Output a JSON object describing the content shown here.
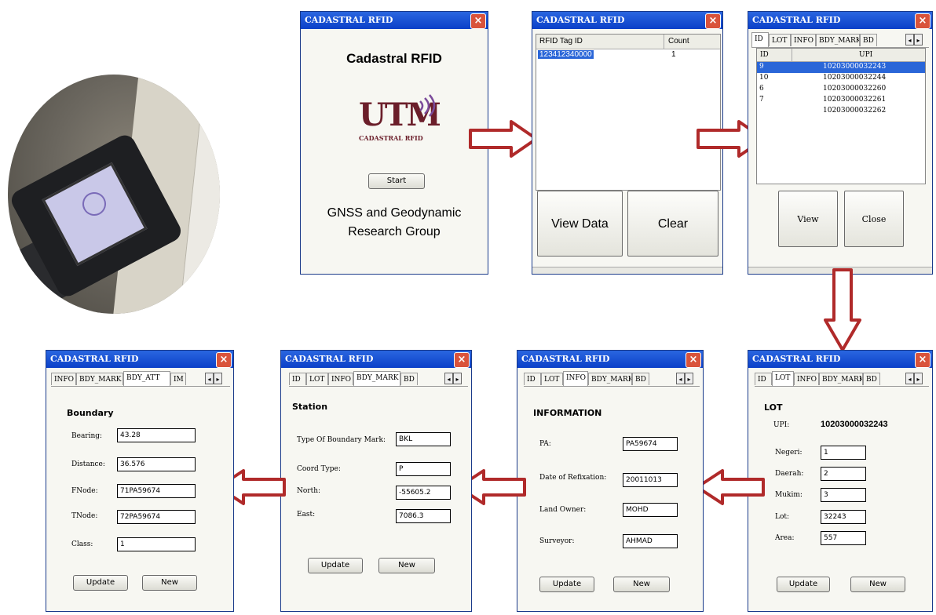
{
  "app_title": "CADASTRAL RFID",
  "close_glyph": "×",
  "colors": {
    "titlebar": "#0b40c8",
    "selection": "#2a66d8",
    "arrow": "#b02a2a"
  },
  "splash": {
    "heading": "Cadastral RFID",
    "logo_text": "UTM",
    "logo_subtext": "CADASTRAL RFID",
    "start_label": "Start",
    "group_line1": "GNSS and Geodynamic",
    "group_line2": "Research Group"
  },
  "reader": {
    "col_tag": "RFID Tag ID",
    "col_count": "Count",
    "rows": [
      {
        "tag": "123412340000",
        "count": "1"
      }
    ],
    "view_data_label": "View Data",
    "clear_label": "Clear"
  },
  "list": {
    "tabs": [
      "ID",
      "LOT",
      "INFO",
      "BDY_MARK",
      "BD"
    ],
    "col_id": "ID",
    "col_upi": "UPI",
    "rows": [
      {
        "id": "9",
        "upi": "10203000032243"
      },
      {
        "id": "10",
        "upi": "10203000032244"
      },
      {
        "id": "6",
        "upi": "10203000032260"
      },
      {
        "id": "7",
        "upi": "10203000032261"
      },
      {
        "id": "",
        "upi": "10203000032262"
      }
    ],
    "view_label": "View",
    "close_label": "Close"
  },
  "lot": {
    "tabs": [
      "ID",
      "LOT",
      "INFO",
      "BDY_MARK",
      "BD"
    ],
    "title": "LOT",
    "upi_label": "UPI:",
    "upi_value": "10203000032243",
    "negeri_label": "Negeri:",
    "negeri_value": "1",
    "daerah_label": "Daerah:",
    "daerah_value": "2",
    "mukim_label": "Mukim:",
    "mukim_value": "3",
    "lot_label": "Lot:",
    "lot_value": "32243",
    "area_label": "Area:",
    "area_value": "557",
    "update_label": "Update",
    "new_label": "New"
  },
  "info": {
    "tabs": [
      "ID",
      "LOT",
      "INFO",
      "BDY_MARK",
      "BD"
    ],
    "title": "INFORMATION",
    "pa_label": "PA:",
    "pa_value": "PA59674",
    "date_label": "Date of Refixation:",
    "date_value": "20011013",
    "owner_label": "Land Owner:",
    "owner_value": "MOHD",
    "surveyor_label": "Surveyor:",
    "surveyor_value": "AHMAD",
    "update_label": "Update",
    "new_label": "New"
  },
  "station": {
    "tabs": [
      "ID",
      "LOT",
      "INFO",
      "BDY_MARK",
      "BD"
    ],
    "title": "Station",
    "type_label": "Type Of Boundary Mark:",
    "type_value": "BKL",
    "coord_label": "Coord Type:",
    "coord_value": "P",
    "north_label": "North:",
    "north_value": "-55605.2",
    "east_label": "East:",
    "east_value": "7086.3",
    "update_label": "Update",
    "new_label": "New"
  },
  "boundary": {
    "tabs": [
      "INFO",
      "BDY_MARK",
      "BDY_ATT",
      "IM"
    ],
    "title": "Boundary",
    "bearing_label": "Bearing:",
    "bearing_value": "43.28",
    "distance_label": "Distance:",
    "distance_value": "36.576",
    "fnode_label": "FNode:",
    "fnode_value": "71PA59674",
    "tnode_label": "TNode:",
    "tnode_value": "72PA59674",
    "class_label": "Class:",
    "class_value": "1",
    "update_label": "Update",
    "new_label": "New"
  }
}
